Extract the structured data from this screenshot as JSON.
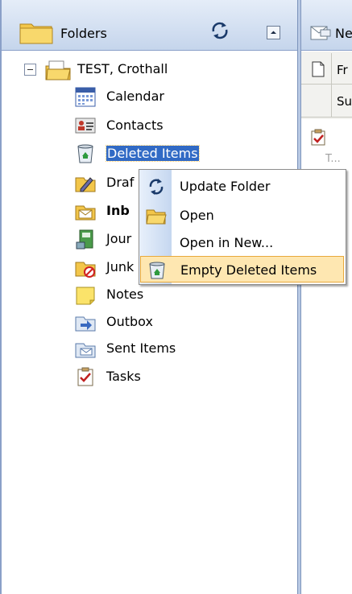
{
  "folders_header": {
    "title": "Folders",
    "sync_icon": "sync-icon",
    "collapse_icon": "chevron-up-icon"
  },
  "tree": {
    "root_label": "TEST, Crothall",
    "items": [
      {
        "label": "Calendar",
        "icon": "calendar-icon",
        "state": "normal"
      },
      {
        "label": "Contacts",
        "icon": "contacts-icon",
        "state": "normal"
      },
      {
        "label": "Deleted Items",
        "icon": "deleted-items-icon",
        "state": "selected"
      },
      {
        "label": "Draf",
        "icon": "drafts-icon",
        "state": "normal"
      },
      {
        "label": "Inb",
        "icon": "inbox-icon",
        "state": "bold"
      },
      {
        "label": "Jour",
        "icon": "journal-icon",
        "state": "normal"
      },
      {
        "label": "Junk",
        "icon": "junk-icon",
        "state": "normal"
      },
      {
        "label": "Notes",
        "icon": "notes-icon",
        "state": "normal"
      },
      {
        "label": "Outbox",
        "icon": "outbox-icon",
        "state": "normal"
      },
      {
        "label": "Sent Items",
        "icon": "sent-items-icon",
        "state": "normal"
      },
      {
        "label": "Tasks",
        "icon": "tasks-icon",
        "state": "normal"
      }
    ]
  },
  "toolbar": {
    "new_label": "Ne"
  },
  "column_headers": {
    "row1": "Fr",
    "row2": "Su"
  },
  "task_preview": {
    "label": "T..."
  },
  "context_menu": {
    "items": [
      {
        "label": "Update Folder",
        "icon": "update-folder-icon",
        "highlighted": false
      },
      {
        "label": "Open",
        "icon": "open-folder-icon",
        "highlighted": false
      },
      {
        "label": "Open in New...",
        "icon": "",
        "highlighted": false
      },
      {
        "label": "Empty Deleted Items",
        "icon": "empty-deleted-items-icon",
        "highlighted": true
      }
    ]
  },
  "colors": {
    "selection": "#316ac5",
    "menu_highlight": "#fee7b1",
    "header_gradient_top": "#e5edf8",
    "header_gradient_bottom": "#c5d5ec"
  }
}
